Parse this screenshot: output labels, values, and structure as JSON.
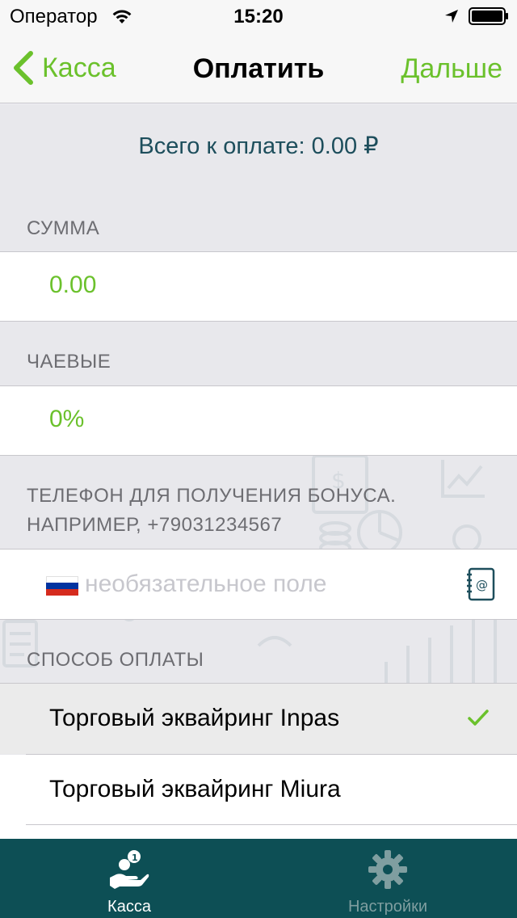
{
  "status_bar": {
    "carrier": "Оператор",
    "time": "15:20"
  },
  "nav": {
    "back_label": "Касса",
    "title": "Оплатить",
    "next_label": "Дальше"
  },
  "total_label": "Всего к оплате: 0.00 ₽",
  "sections": {
    "amount": {
      "header": "СУММА",
      "value": "0.00"
    },
    "tips": {
      "header": "ЧАЕВЫЕ",
      "value": "0%"
    },
    "phone": {
      "header_line1": "ТЕЛЕФОН ДЛЯ ПОЛУЧЕНИЯ БОНУСА.",
      "header_line2": "НАПРИМЕР, +79031234567",
      "placeholder": "необязательное поле",
      "value": ""
    },
    "payment_method": {
      "header": "СПОСОБ ОПЛАТЫ",
      "options": [
        {
          "label": "Торговый эквайринг Inpas",
          "selected": true
        },
        {
          "label": "Торговый эквайринг Miura",
          "selected": false
        }
      ]
    }
  },
  "tab_bar": {
    "tabs": [
      {
        "label": "Касса",
        "icon": "cash-hand-icon",
        "active": true
      },
      {
        "label": "Настройки",
        "icon": "gear-icon",
        "active": false
      }
    ]
  },
  "colors": {
    "accent": "#6bc12c",
    "total_text": "#1d4e5c",
    "tab_bar_bg": "#0d4f55",
    "tab_active": "#ffffff",
    "tab_inactive": "#7f9ea0"
  }
}
